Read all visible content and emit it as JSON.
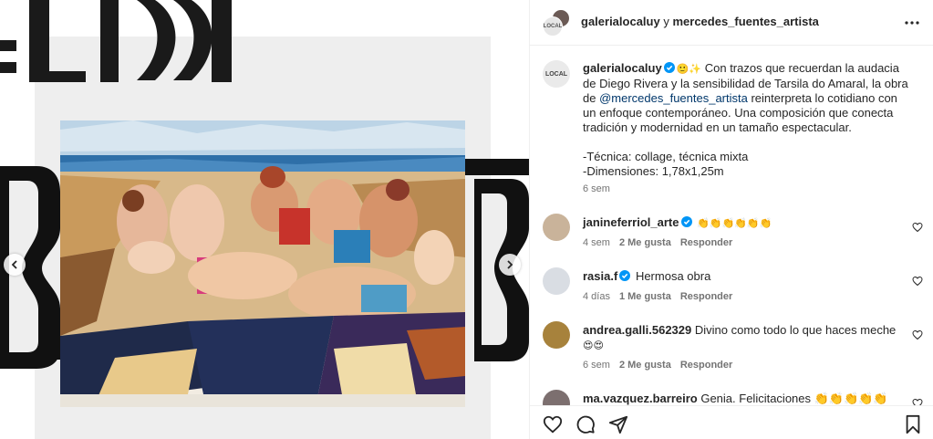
{
  "header": {
    "user1": "galerialocaluy",
    "conjunction": "y",
    "user2": "mercedes_fuentes_artista",
    "more_icon": "more-horizontal-icon"
  },
  "caption": {
    "username": "galerialocaluy",
    "emojis": "🙂✨",
    "text_1": " Con trazos que recuerdan la audacia de Diego Rivera y la sensibilidad de Tarsila do Amaral, la obra de ",
    "mention": "@mercedes_fuentes_artista",
    "text_2": " reinterpreta lo cotidiano con un enfoque contemporáneo. Una composición que conecta tradición y modernidad en un tamaño espectacular.",
    "technique": "-Técnica: collage, técnica mixta",
    "dimensions": "-Dimensiones: 1,78x1,25m",
    "time": "6 sem",
    "avatar_text": "LOCAL"
  },
  "comments": [
    {
      "username": "janineferriol_arte",
      "verified": true,
      "text": "👏👏👏👏👏👏",
      "time": "4 sem",
      "likes": "2 Me gusta",
      "reply": "Responder"
    },
    {
      "username": "rasia.f",
      "verified": true,
      "text": "Hermosa obra",
      "time": "4 días",
      "likes": "1 Me gusta",
      "reply": "Responder"
    },
    {
      "username": "andrea.galli.562329",
      "verified": false,
      "text": "Divino como todo lo que haces meche",
      "text_2": "😍😍",
      "time": "6 sem",
      "likes": "2 Me gusta",
      "reply": "Responder"
    },
    {
      "username": "ma.vazquez.barreiro",
      "verified": false,
      "text": "Genia. Felicitaciones 👏👏👏👏👏"
    }
  ],
  "colors": {
    "link": "#00376b",
    "verified": "#0095f6",
    "meta": "#737373",
    "text": "#262626"
  }
}
